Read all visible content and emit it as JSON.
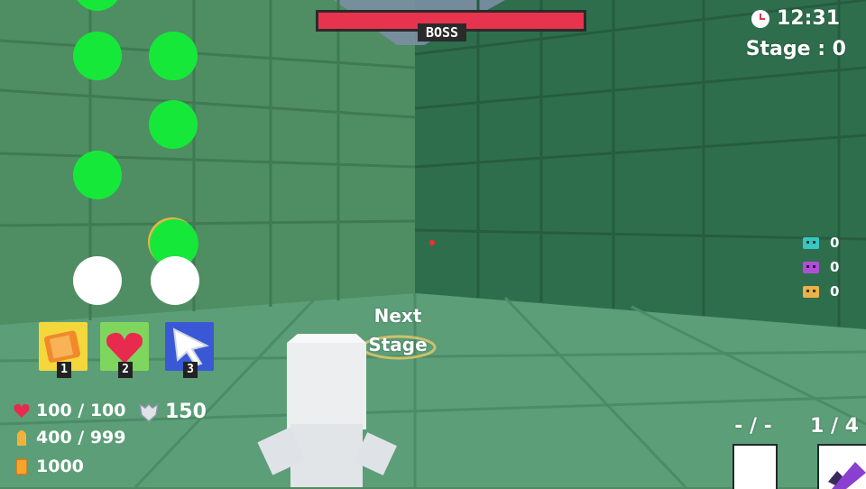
{
  "boss": {
    "label": "BOSS",
    "health_fraction": 1.0
  },
  "clock": {
    "time": "12:31"
  },
  "stage": {
    "label": "Stage : 0"
  },
  "next_stage": {
    "line1": "Next",
    "line2": "Stage"
  },
  "skills": [
    {
      "key": "1",
      "icon": "orange-scroll-icon"
    },
    {
      "key": "2",
      "icon": "heart-icon"
    },
    {
      "key": "3",
      "icon": "cursor-arrow-icon"
    }
  ],
  "stats": {
    "health": "100 / 100",
    "ammo": "400 / 999",
    "gold": "1000",
    "armor": "150"
  },
  "enemy_counters": [
    {
      "icon": "teal-enemy-icon",
      "color": "#38c7c0",
      "count": "0"
    },
    {
      "icon": "purple-enemy-icon",
      "color": "#b04fd6",
      "count": "0"
    },
    {
      "icon": "yellow-enemy-icon",
      "color": "#e8b24a",
      "count": "0"
    }
  ],
  "weapon_slots": {
    "slot1_label": "- / -",
    "slot2_label": "1 / 4"
  },
  "colors": {
    "boss_bar": "#e8334f",
    "green_dot": "#16e83a",
    "white_dot": "#ffffff"
  }
}
